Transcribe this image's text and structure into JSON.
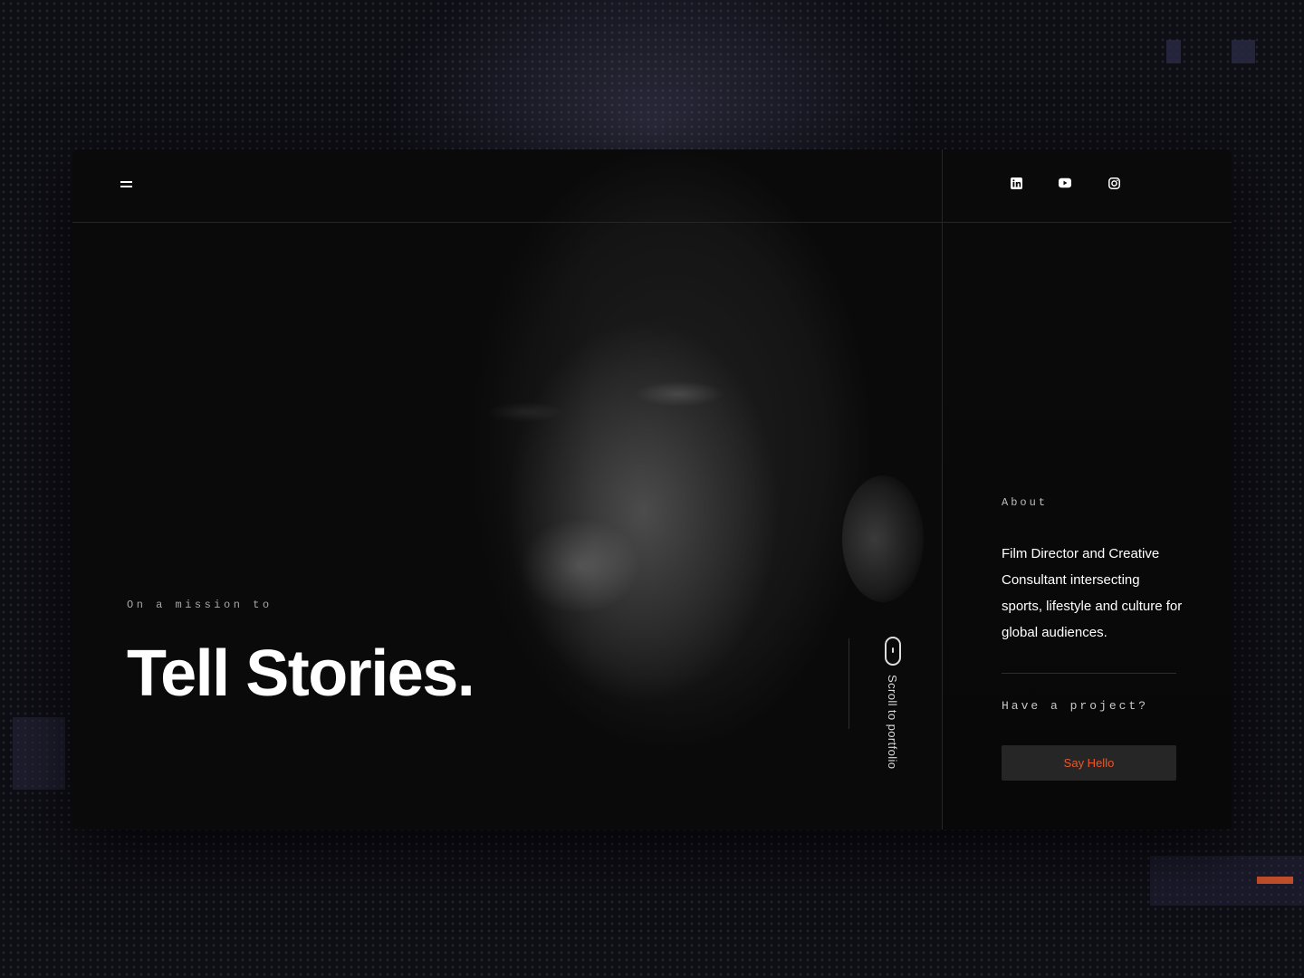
{
  "nav": {
    "menu_icon": "hamburger-menu-icon",
    "socials": [
      {
        "name": "linkedin",
        "icon": "linkedin-icon"
      },
      {
        "name": "youtube",
        "icon": "youtube-icon"
      },
      {
        "name": "instagram",
        "icon": "instagram-icon"
      }
    ]
  },
  "hero": {
    "eyebrow": "On a mission to",
    "headline": "Tell Stories.",
    "scroll_label": "Scroll to portfolio",
    "scroll_icon": "mouse-scroll-icon"
  },
  "about": {
    "label": "About",
    "text": "Film Director and Creative Consultant intersecting sports, lifestyle and culture for global audiences.",
    "project_label": "Have a project?",
    "cta_label": "Say Hello"
  },
  "colors": {
    "accent": "#e8582c",
    "background": "#0a0a0a",
    "panel_button": "#262626"
  }
}
